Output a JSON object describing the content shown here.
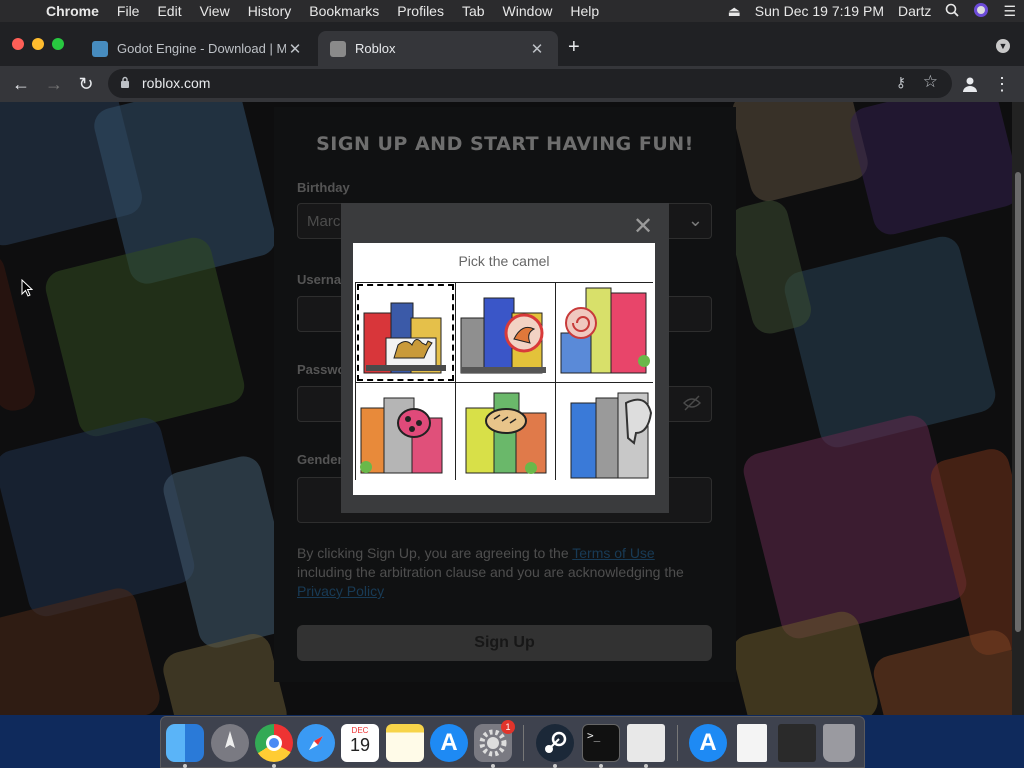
{
  "menubar": {
    "app": "Chrome",
    "items": [
      "File",
      "Edit",
      "View",
      "History",
      "Bookmarks",
      "Profiles",
      "Tab",
      "Window",
      "Help"
    ],
    "datetime": "Sun Dec 19  7:19 PM",
    "user": "Dartz"
  },
  "tabs": [
    {
      "title": "Godot Engine - Download | Ma"
    },
    {
      "title": "Roblox"
    }
  ],
  "omnibox": {
    "url": "roblox.com"
  },
  "signup": {
    "heading": "SIGN UP AND START HAVING FUN!",
    "birthday_label": "Birthday",
    "birthday_value": "Marc",
    "username_label": "Userna",
    "password_label": "Passwo",
    "gender_label": "Gender",
    "terms_prefix": "By clicking Sign Up, you are agreeing to the ",
    "terms_link": "Terms of Use",
    "terms_middle": " including the arbitration clause and you are acknowledging the ",
    "privacy_link": "Privacy Policy",
    "button": "Sign Up"
  },
  "captcha": {
    "prompt": "Pick the camel",
    "tiles": [
      "camel",
      "kangaroo",
      "snail",
      "ladybug",
      "bread",
      "elephant"
    ],
    "selected_index": 0
  },
  "dock": {
    "apps": [
      "Finder",
      "Launchpad",
      "Chrome",
      "Safari",
      "Calendar",
      "Notes",
      "App Store",
      "System Preferences",
      "Steam",
      "Terminal",
      "Preview",
      "App Store Folder",
      "Document",
      "Screenshot",
      "Trash"
    ],
    "calendar_month": "DEC",
    "calendar_day": "19",
    "prefs_badge": "1"
  }
}
